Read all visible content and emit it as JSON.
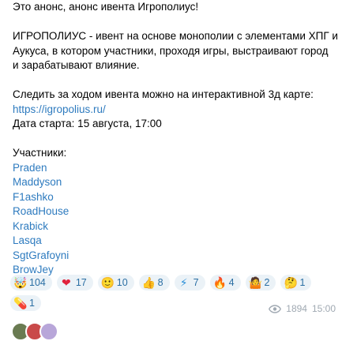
{
  "message": {
    "intro": "Это анонс, анонс ивента Игрополиус!",
    "description_1": "ИГРОПОЛИУС - ивент на основе монополии с элементами ХПГ и",
    "description_2": "Аукуса, в котором участники, проходя игры, выстраивают город",
    "description_3": "и зарабатывают влияние.",
    "map_text": "Следить за ходом ивента можно на интерактивной 3д карте:",
    "map_link": "https://igropolius.ru/",
    "start_date": "Дата старта: 15 августа, 17:00",
    "participants_heading": "Участники:",
    "participants": [
      "Praden",
      "Maddyson",
      "F1ashko",
      "RoadHouse",
      "Krabick",
      "Lasqa",
      "SgtGrafoyni",
      "BrowJey"
    ]
  },
  "reactions": [
    {
      "icon": "exploding-head-emoji",
      "glyph": "🤯",
      "count": "104"
    },
    {
      "icon": "heart-emoji",
      "glyph": "❤",
      "count": "17"
    },
    {
      "icon": "custom-face-emoji",
      "glyph": "🙂",
      "count": "10"
    },
    {
      "icon": "thumbs-up-emoji",
      "glyph": "👍",
      "count": "8"
    },
    {
      "icon": "lightning-emoji",
      "glyph": "⚡",
      "count": "7"
    },
    {
      "icon": "fire-emoji",
      "glyph": "🔥",
      "count": "4"
    },
    {
      "icon": "shrug-emoji",
      "glyph": "🤷",
      "count": "2"
    },
    {
      "icon": "thinking-emoji",
      "glyph": "🤔",
      "count": "1"
    },
    {
      "icon": "pill-emoji",
      "glyph": "💊",
      "count": "1"
    }
  ],
  "meta": {
    "views": "1894",
    "time": "15:00"
  },
  "colors": {
    "link": "#2e7bbf",
    "chip_bg": "#ebf2f7",
    "chip_text": "#2a6ea3",
    "meta_text": "#a0a9b2"
  }
}
